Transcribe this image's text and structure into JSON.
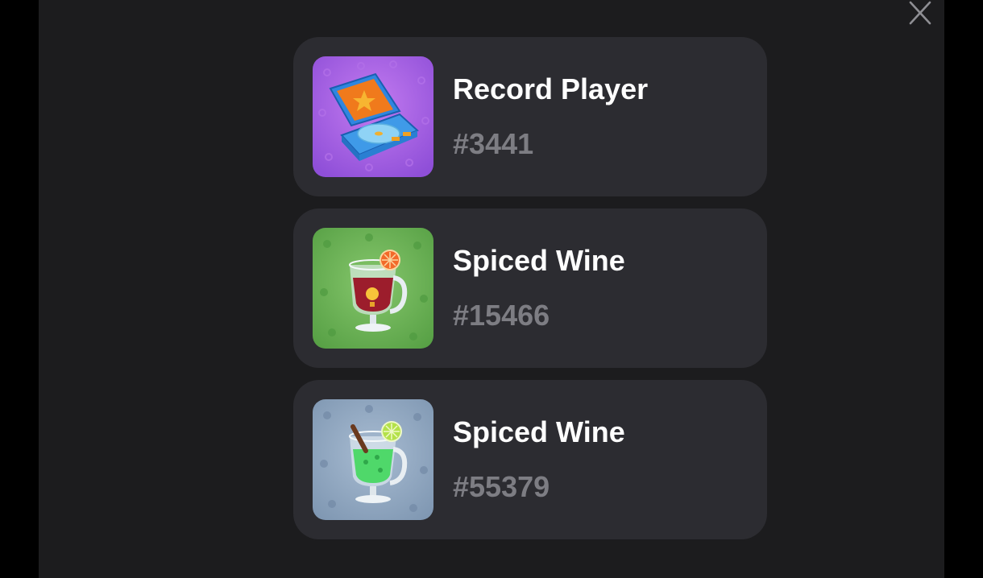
{
  "modal": {
    "close_icon": "close-icon"
  },
  "items": [
    {
      "name": "Record Player",
      "number": "#3441",
      "icon": "record-player-icon",
      "background": "#a45ee0"
    },
    {
      "name": "Spiced Wine",
      "number": "#15466",
      "icon": "spiced-wine-red-icon",
      "background": "#6fb35a"
    },
    {
      "name": "Spiced Wine",
      "number": "#55379",
      "icon": "spiced-wine-green-icon",
      "background": "#8fa6bf"
    }
  ],
  "colors": {
    "page_background": "#000000",
    "modal_background": "#1c1c1e",
    "card_background": "#2c2c31",
    "title_text": "#ffffff",
    "number_text": "#7d7d83"
  }
}
